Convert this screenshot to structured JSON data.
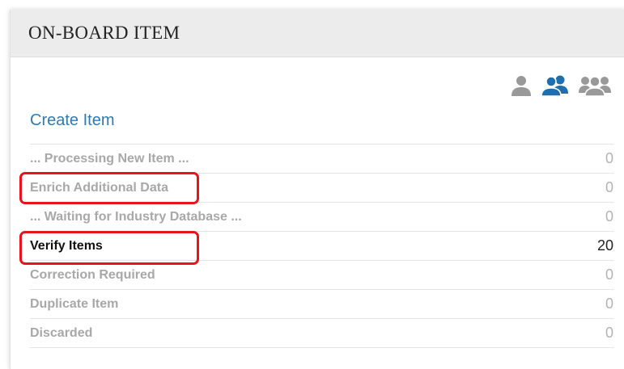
{
  "header": {
    "title": "ON-BOARD ITEM"
  },
  "view_icons": [
    {
      "name": "single-user-icon",
      "color": "#999999"
    },
    {
      "name": "two-users-icon",
      "color": "#1f6fae"
    },
    {
      "name": "group-users-icon",
      "color": "#999999"
    }
  ],
  "create_link": "Create Item",
  "statuses": [
    {
      "label": "... Processing New Item ...",
      "count": "0"
    },
    {
      "label": "Enrich Additional Data",
      "count": "0",
      "highlighted": true
    },
    {
      "label": "... Waiting for Industry Database ...",
      "count": "0"
    },
    {
      "label": "Verify Items",
      "count": "20",
      "highlighted": true,
      "active": true
    },
    {
      "label": "Correction Required",
      "count": "0"
    },
    {
      "label": "Duplicate Item",
      "count": "0"
    },
    {
      "label": "Discarded",
      "count": "0"
    }
  ],
  "colors": {
    "accent": "#2c7bb6",
    "highlight": "#e8141a",
    "muted_text": "#a8a8a8"
  }
}
